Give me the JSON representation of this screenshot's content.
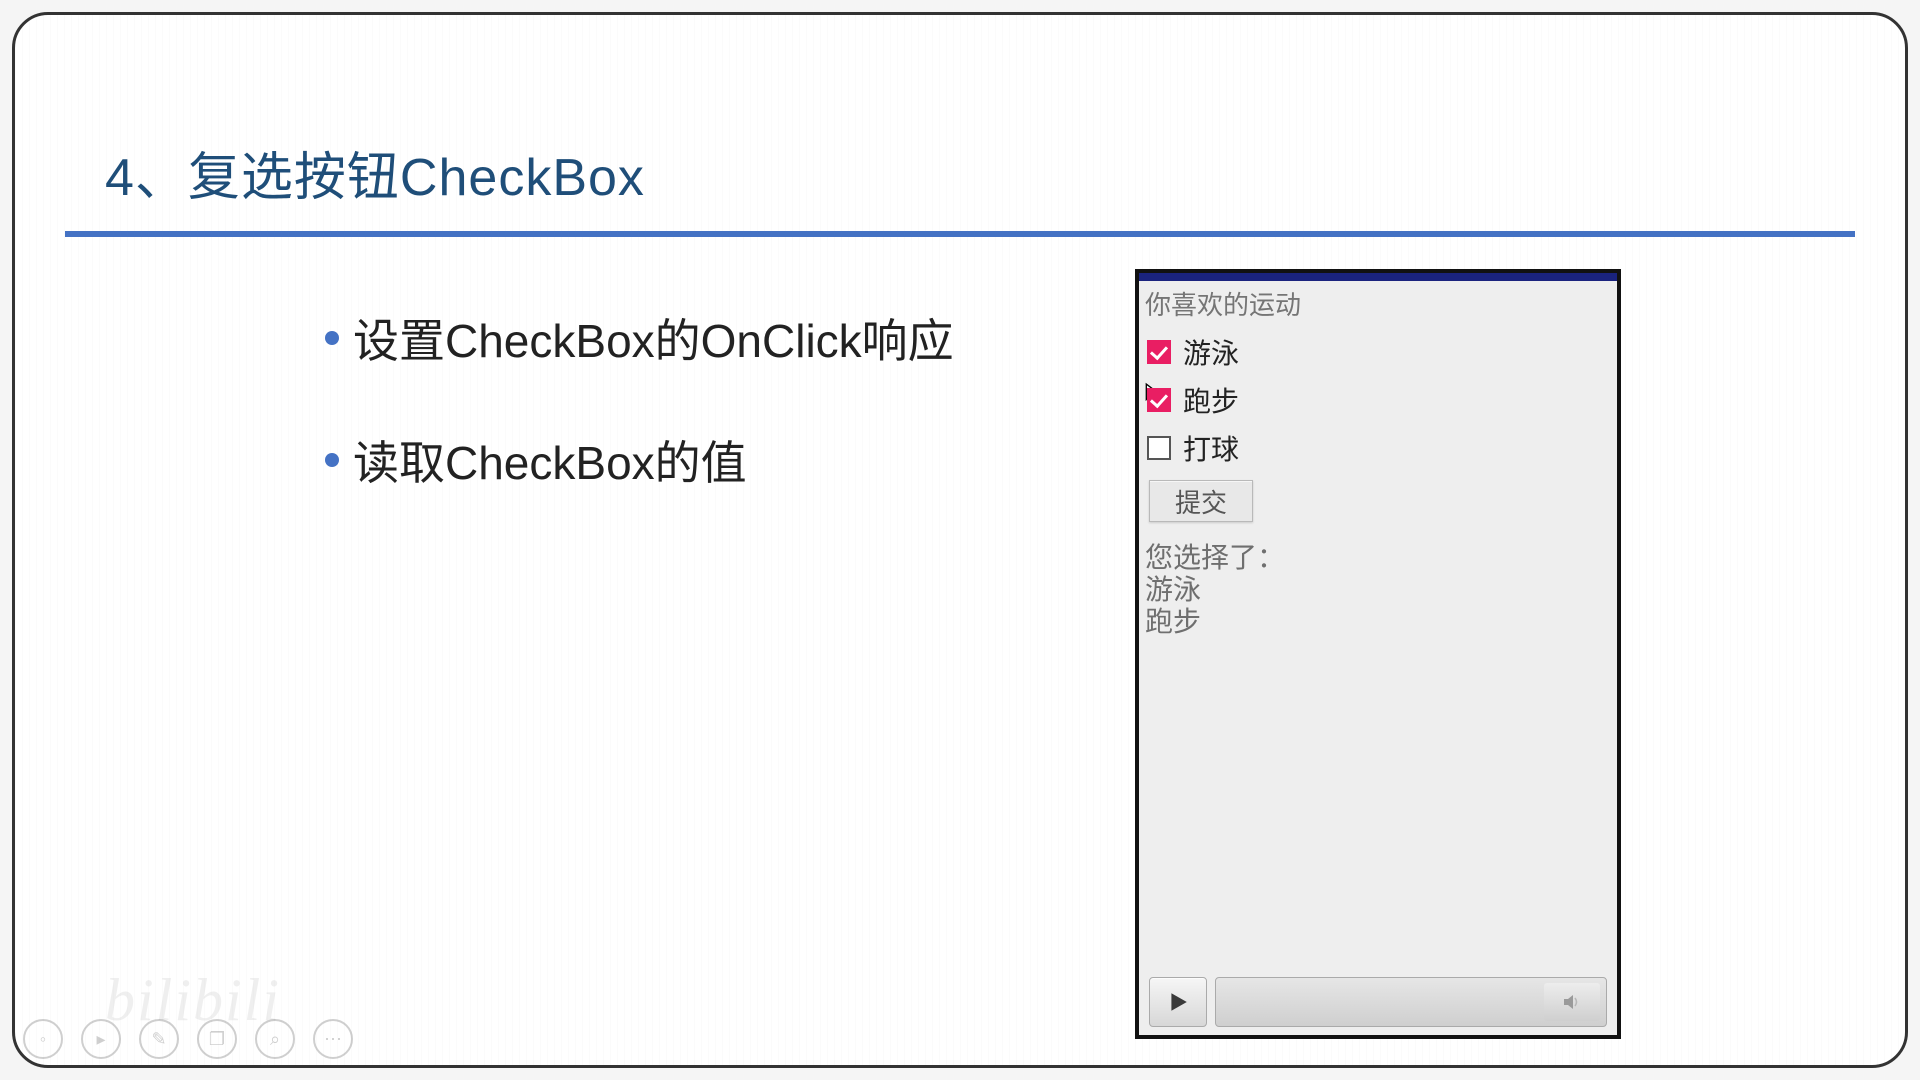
{
  "slide": {
    "title": "4、复选按钮CheckBox",
    "bullets": [
      "设置CheckBox的OnClick响应",
      "读取CheckBox的值"
    ]
  },
  "phone": {
    "prompt": "你喜欢的运动",
    "options": [
      {
        "label": "游泳",
        "checked": true
      },
      {
        "label": "跑步",
        "checked": true
      },
      {
        "label": "打球",
        "checked": false
      }
    ],
    "submit_label": "提交",
    "result_heading": "您选择了：",
    "result_items": [
      "游泳",
      "跑步"
    ]
  },
  "icons": {
    "play": "play-icon",
    "speaker": "speaker-icon"
  }
}
